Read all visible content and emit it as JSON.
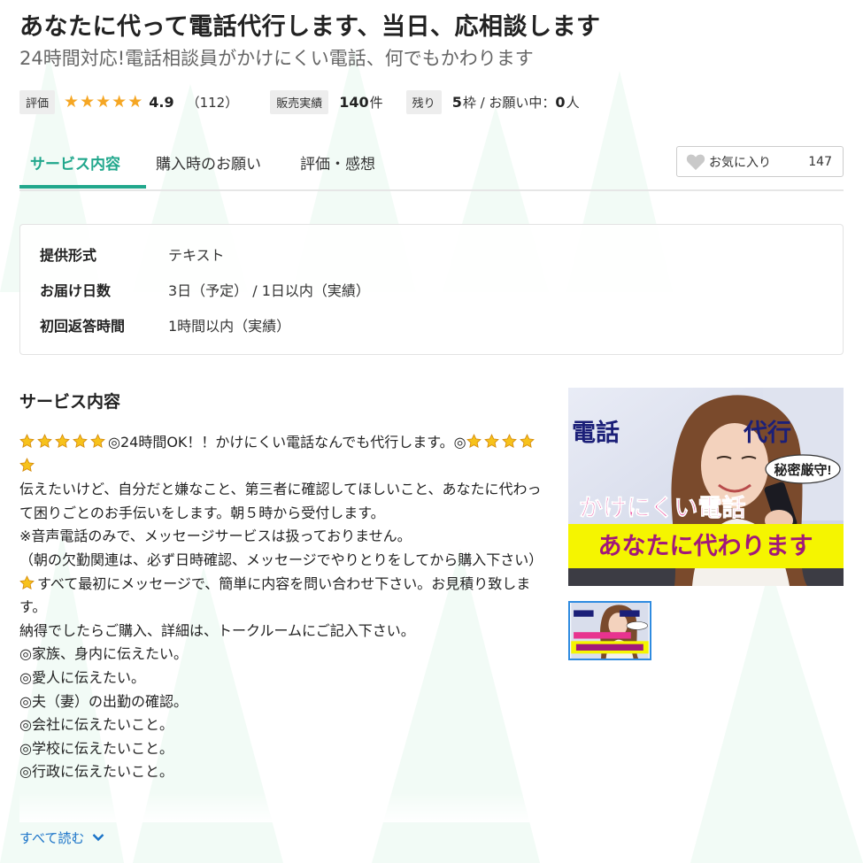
{
  "header": {
    "title": "あなたに代って電話代行します、当日、応相談します",
    "subtitle": "24時間対応!電話相談員がかけにくい電話、何でもかわります"
  },
  "meta": {
    "rating_label": "評価",
    "rating_value": "4.9",
    "rating_stars": 5,
    "review_count": "（112）",
    "sales_label": "販売実績",
    "sales_count": "140",
    "sales_unit": "件",
    "remain_label": "残り",
    "remain_slots": "5",
    "remain_unit": "枠 / お願い中：",
    "in_progress": "0",
    "in_progress_unit": "人"
  },
  "tabs": [
    {
      "label": "サービス内容",
      "active": true
    },
    {
      "label": "購入時のお願い",
      "active": false
    },
    {
      "label": "評価・感想",
      "active": false
    }
  ],
  "favorite": {
    "label": "お気に入り",
    "count": "147",
    "icon": "heart-icon"
  },
  "info": [
    {
      "key": "提供形式",
      "value": "テキスト"
    },
    {
      "key": "お届け日数",
      "value": "3日（予定） / 1日以内（実績）"
    },
    {
      "key": "初回返答時間",
      "value": "1時間以内（実績）"
    }
  ],
  "service": {
    "section_title": "サービス内容",
    "line1_text": "◎24時間OK！！かけにくい電話なんでも代行します。◎",
    "lines": [
      "伝えたいけど、自分だと嫌なこと、第三者に確認してほしいこと、あなたに代わって困りごとのお手伝いをします。朝５時から受付します。",
      "※音声電話のみで、メッセージサービスは扱っておりません。",
      "（朝の欠勤関連は、必ず日時確認、メッセージでやりとりをしてから購入下さい）"
    ],
    "star_line": "すべて最初にメッセージで、簡単に内容を問い合わせ下さい。お見積り致します。",
    "lines2": [
      "納得でしたらご購入、詳細は、トークルームにご記入下さい。",
      "◎家族、身内に伝えたい。",
      "◎愛人に伝えたい。",
      "◎夫（妻）の出勤の確認。",
      "◎会社に伝えたいこと。",
      "◎学校に伝えたいこと。",
      "◎行政に伝えたいこと。"
    ],
    "read_more": "すべて読む"
  },
  "image": {
    "text_top_left": "電話",
    "text_top_right": "代行",
    "badge": "秘密厳守!",
    "line_pink": "かけにくい電話",
    "line_yellow": "あなたに代わります"
  },
  "colors": {
    "accent": "#21a78c",
    "star": "#f5a623",
    "link": "#1a73c8",
    "image_yellow": "#f5f500",
    "image_pink": "#e8338f",
    "image_navy": "#1b1f78"
  }
}
